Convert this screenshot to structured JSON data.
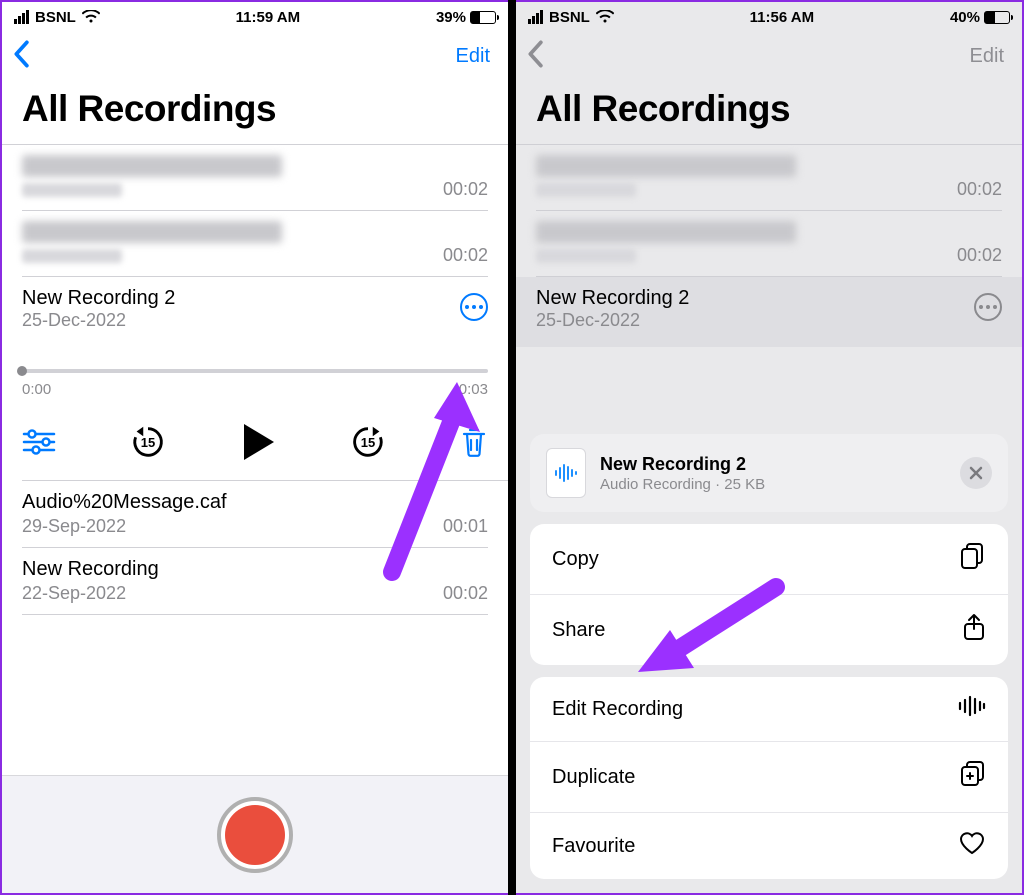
{
  "left": {
    "status": {
      "carrier": "BSNL",
      "time": "11:59 AM",
      "battery_pct": "39%",
      "battery_fill": 39
    },
    "nav": {
      "edit": "Edit"
    },
    "title": "All Recordings",
    "blurred": [
      {
        "dur": "00:02"
      },
      {
        "dur": "00:02"
      }
    ],
    "selected": {
      "title": "New Recording 2",
      "date": "25-Dec-2022",
      "time_cur": "0:00",
      "time_rem": "-0:03",
      "skip_amount": "15"
    },
    "items": [
      {
        "title": "Audio%20Message.caf",
        "date": "29-Sep-2022",
        "dur": "00:01"
      },
      {
        "title": "New Recording",
        "date": "22-Sep-2022",
        "dur": "00:02"
      }
    ]
  },
  "right": {
    "status": {
      "carrier": "BSNL",
      "time": "11:56 AM",
      "battery_pct": "40%",
      "battery_fill": 40
    },
    "nav": {
      "edit": "Edit"
    },
    "title": "All Recordings",
    "blurred": [
      {
        "dur": "00:02"
      },
      {
        "dur": "00:02"
      }
    ],
    "selected": {
      "title": "New Recording 2",
      "date": "25-Dec-2022"
    },
    "sheet": {
      "file_title": "New Recording 2",
      "file_sub": "Audio Recording · 25 KB",
      "group1": [
        {
          "label": "Copy"
        },
        {
          "label": "Share"
        }
      ],
      "group2": [
        {
          "label": "Edit Recording"
        },
        {
          "label": "Duplicate"
        },
        {
          "label": "Favourite"
        }
      ]
    }
  }
}
